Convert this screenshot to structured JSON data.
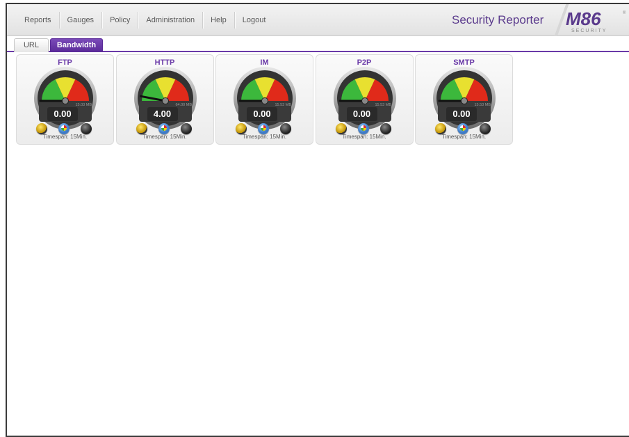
{
  "header": {
    "menu": [
      "Reports",
      "Gauges",
      "Policy",
      "Administration",
      "Help",
      "Logout"
    ],
    "title": "Security Reporter",
    "logo_text": "M86",
    "logo_subtext": "SECURITY",
    "brand_color": "#5a3a8c"
  },
  "tabs": [
    {
      "label": "URL",
      "active": false
    },
    {
      "label": "Bandwidth",
      "active": true
    }
  ],
  "gauges": [
    {
      "name": "FTP",
      "value": "0.00",
      "max_label": "15.03 MB",
      "needle": 0.0,
      "timespan": "Timespan: 15Min."
    },
    {
      "name": "HTTP",
      "value": "4.00",
      "max_label": "64.00 MB",
      "needle": 0.06,
      "timespan": "Timespan: 15Min."
    },
    {
      "name": "IM",
      "value": "0.00",
      "max_label": "15.53 MB",
      "needle": 0.0,
      "timespan": "Timespan: 15Min."
    },
    {
      "name": "P2P",
      "value": "0.00",
      "max_label": "15.53 MB",
      "needle": 0.0,
      "timespan": "Timespan: 15Min."
    },
    {
      "name": "SMTP",
      "value": "0.00",
      "max_label": "15.53 MB",
      "needle": 0.0,
      "timespan": "Timespan: 15Min."
    }
  ]
}
